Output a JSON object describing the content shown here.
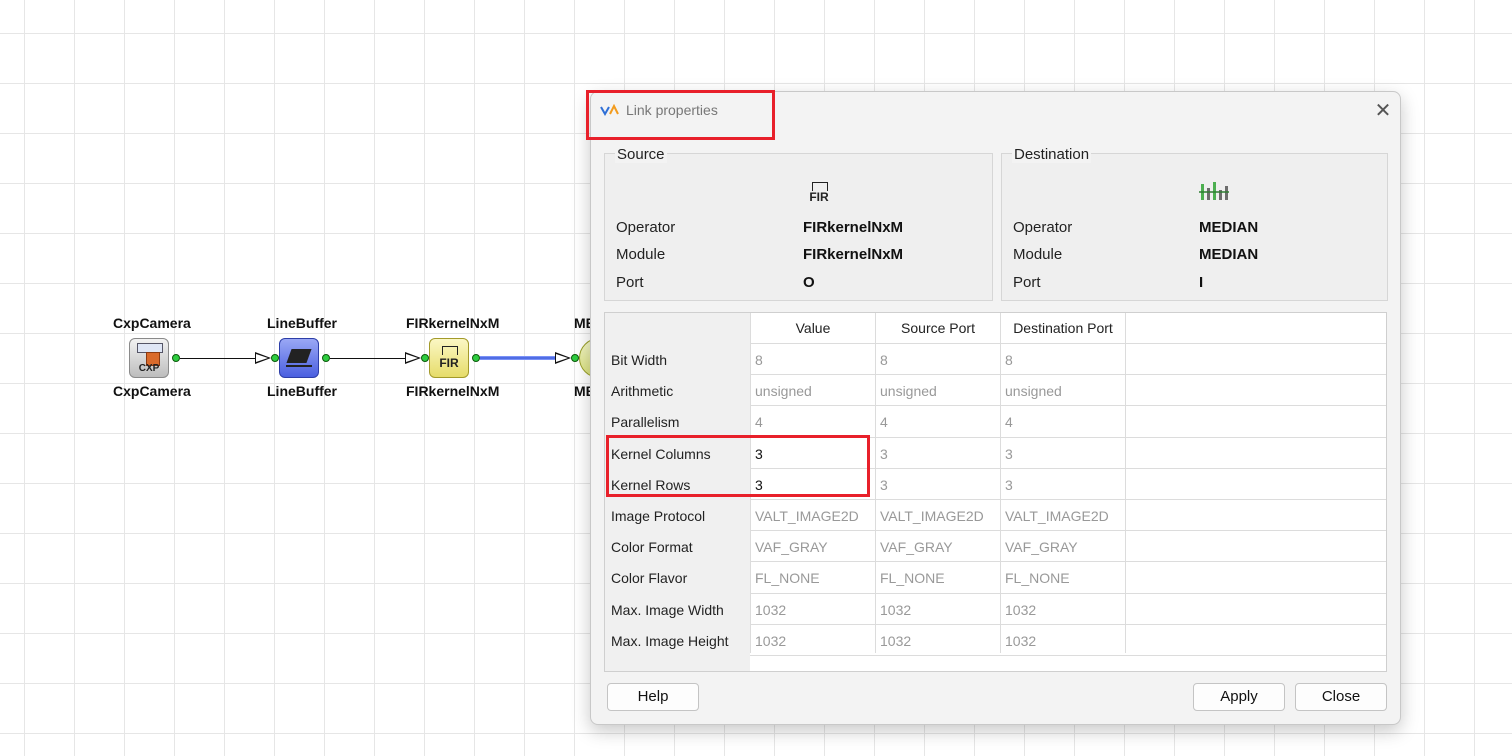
{
  "canvas": {
    "nodes": [
      {
        "label_top": "CxpCamera",
        "label_bottom": "CxpCamera",
        "icon": "cxp-camera-icon",
        "icon_text": "CXP"
      },
      {
        "label_top": "LineBuffer",
        "label_bottom": "LineBuffer",
        "icon": "line-buffer-icon",
        "icon_text": ""
      },
      {
        "label_top": "FIRkernelNxM",
        "label_bottom": "FIRkernelNxM",
        "icon": "fir-icon",
        "icon_text": "FIR"
      },
      {
        "label_top": "ME",
        "label_bottom": "ME",
        "icon": "median-icon",
        "icon_text": ""
      }
    ]
  },
  "dialog": {
    "title": "Link properties",
    "close_glyph": "✕",
    "source": {
      "title": "Source",
      "icon_text": "FIR",
      "labels": [
        "Operator",
        "Module",
        "Port"
      ],
      "operator": "FIRkernelNxM",
      "module": "FIRkernelNxM",
      "port": "O"
    },
    "destination": {
      "title": "Destination",
      "labels": [
        "Operator",
        "Module",
        "Port"
      ],
      "operator": "MEDIAN",
      "module": "MEDIAN",
      "port": "I"
    },
    "table": {
      "columns": [
        "Value",
        "Source Port",
        "Destination Port"
      ],
      "rows": [
        {
          "name": "Bit Width",
          "value": "8",
          "source": "8",
          "dest": "8"
        },
        {
          "name": "Arithmetic",
          "value": "unsigned",
          "source": "unsigned",
          "dest": "unsigned"
        },
        {
          "name": "Parallelism",
          "value": "4",
          "source": "4",
          "dest": "4"
        },
        {
          "name": "Kernel Columns",
          "value": "3",
          "source": "3",
          "dest": "3"
        },
        {
          "name": "Kernel Rows",
          "value": "3",
          "source": "3",
          "dest": "3"
        },
        {
          "name": "Image Protocol",
          "value": "VALT_IMAGE2D",
          "source": "VALT_IMAGE2D",
          "dest": "VALT_IMAGE2D"
        },
        {
          "name": "Color Format",
          "value": "VAF_GRAY",
          "source": "VAF_GRAY",
          "dest": "VAF_GRAY"
        },
        {
          "name": "Color Flavor",
          "value": "FL_NONE",
          "source": "FL_NONE",
          "dest": "FL_NONE"
        },
        {
          "name": "Max. Image Width",
          "value": "1032",
          "source": "1032",
          "dest": "1032"
        },
        {
          "name": "Max. Image Height",
          "value": "1032",
          "source": "1032",
          "dest": "1032"
        }
      ]
    },
    "buttons": {
      "help": "Help",
      "apply": "Apply",
      "close": "Close"
    }
  },
  "colors": {
    "highlight": "#e8202a",
    "port_dot": "#2ecc40",
    "selected_link": "#3b5bdb"
  }
}
